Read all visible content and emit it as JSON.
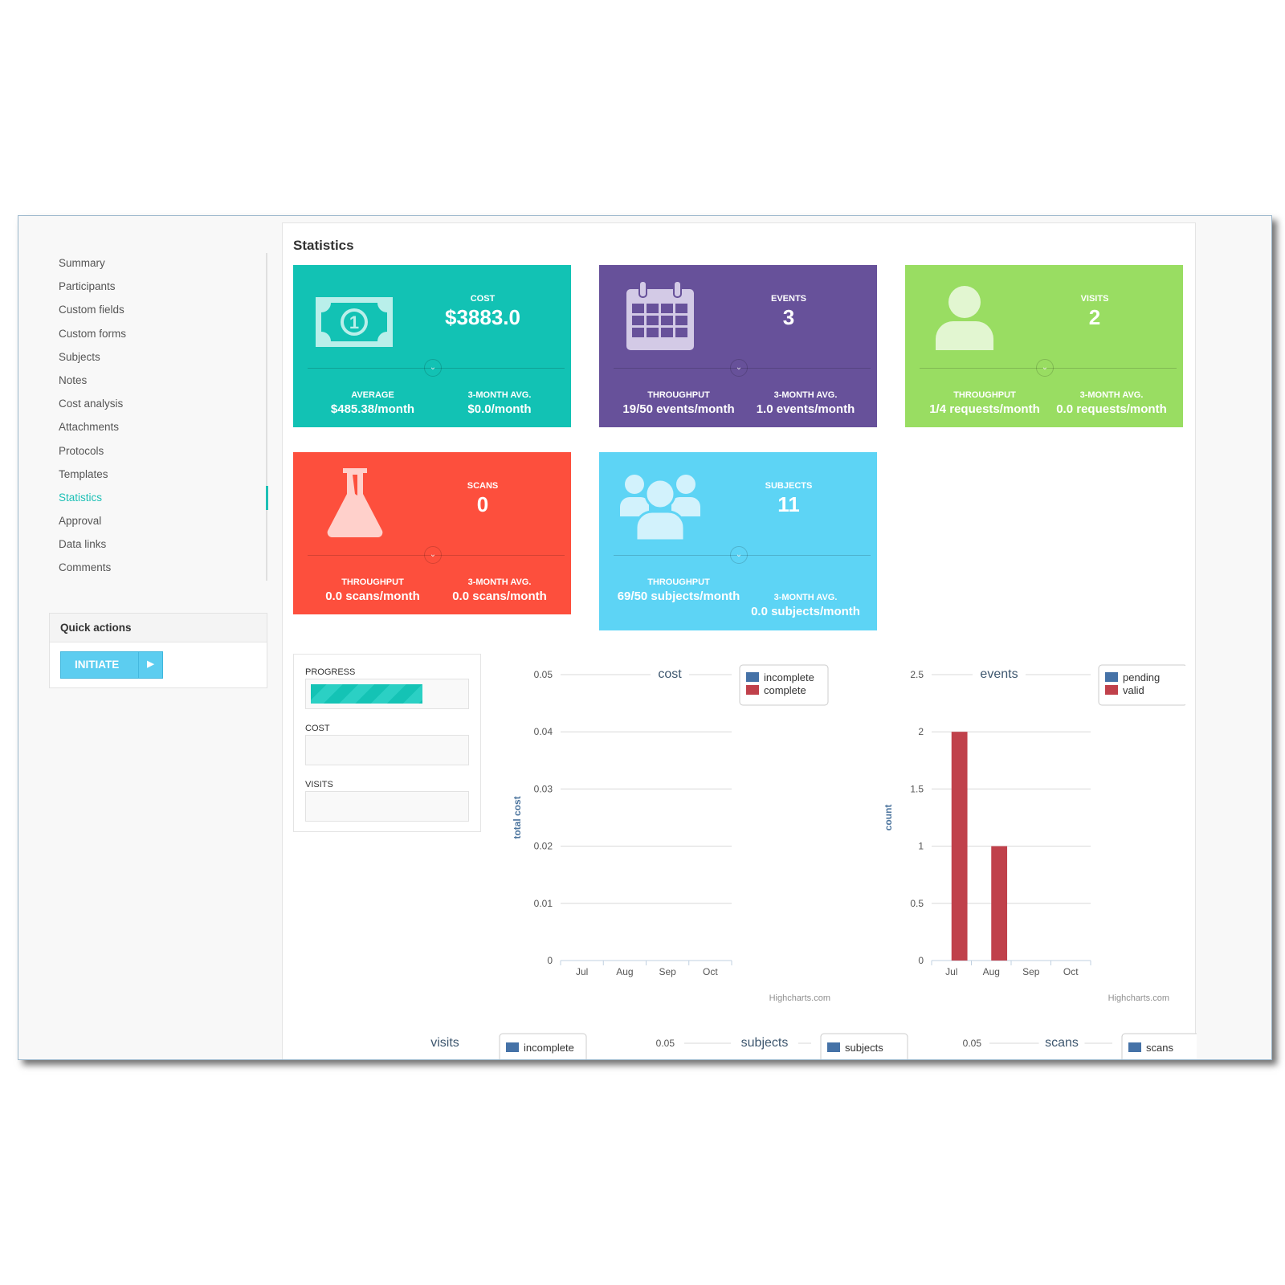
{
  "sidebar": {
    "items": [
      {
        "label": "Summary"
      },
      {
        "label": "Participants"
      },
      {
        "label": "Custom fields"
      },
      {
        "label": "Custom forms"
      },
      {
        "label": "Subjects"
      },
      {
        "label": "Notes"
      },
      {
        "label": "Cost analysis"
      },
      {
        "label": "Attachments"
      },
      {
        "label": "Protocols"
      },
      {
        "label": "Templates"
      },
      {
        "label": "Statistics",
        "active": true
      },
      {
        "label": "Approval"
      },
      {
        "label": "Data links"
      },
      {
        "label": "Comments"
      }
    ],
    "quick_actions": {
      "title": "Quick actions",
      "initiate_label": "INITIATE",
      "arrow_icon": "play-icon"
    }
  },
  "page": {
    "title": "Statistics"
  },
  "cards": [
    {
      "id": "cost",
      "icon": "banknote-icon",
      "label": "COST",
      "value": "$3883.0",
      "left_label": "AVERAGE",
      "left_value": "$485.38/month",
      "right_label": "3-MONTH AVG.",
      "right_value": "$0.0/month",
      "color": "#12c2b4"
    },
    {
      "id": "events",
      "icon": "calendar-icon",
      "label": "EVENTS",
      "value": "3",
      "left_label": "THROUGHPUT",
      "left_value": "19/50 events/month",
      "right_label": "3-MONTH AVG.",
      "right_value": "1.0 events/month",
      "color": "#67519a"
    },
    {
      "id": "visits",
      "icon": "user-icon",
      "label": "VISITS",
      "value": "2",
      "left_label": "THROUGHPUT",
      "left_value": "1/4 requests/month",
      "right_label": "3-MONTH AVG.",
      "right_value": "0.0 requests/month",
      "color": "#99dd62"
    },
    {
      "id": "scans",
      "icon": "flask-icon",
      "label": "SCANS",
      "value": "0",
      "left_label": "THROUGHPUT",
      "left_value": "0.0 scans/month",
      "right_label": "3-MONTH AVG.",
      "right_value": "0.0 scans/month",
      "color": "#fd4f3d"
    },
    {
      "id": "subjects",
      "icon": "group-icon",
      "label": "SUBJECTS",
      "value": "11",
      "left_label": "THROUGHPUT",
      "left_value": "69/50 subjects/month",
      "right_label": "3-MONTH AVG.",
      "right_value": "0.0 subjects/month",
      "color": "#5dd4f5"
    }
  ],
  "progress_panel": {
    "progress_label": "PROGRESS",
    "progress_fraction": 0.73,
    "cost_label": "COST",
    "visits_label": "VISITS"
  },
  "chart_data": [
    {
      "type": "bar",
      "title": "cost",
      "ylabel": "total cost",
      "xlabel": "",
      "categories": [
        "Jul",
        "Aug",
        "Sep",
        "Oct"
      ],
      "yticks": [
        "0",
        "0.01",
        "0.02",
        "0.03",
        "0.04",
        "0.05"
      ],
      "ylim": [
        0,
        0.05
      ],
      "series": [
        {
          "name": "incomplete",
          "color": "#4572a7",
          "values": [
            0,
            0,
            0,
            0
          ]
        },
        {
          "name": "complete",
          "color": "#c0414b",
          "values": [
            0,
            0,
            0,
            0
          ]
        }
      ],
      "legend": "top-right",
      "credit": "Highcharts.com"
    },
    {
      "type": "bar",
      "title": "events",
      "ylabel": "count",
      "xlabel": "",
      "categories": [
        "Jul",
        "Aug",
        "Sep",
        "Oct"
      ],
      "yticks": [
        "0",
        "0.5",
        "1",
        "1.5",
        "2",
        "2.5"
      ],
      "ylim": [
        0,
        2.5
      ],
      "series": [
        {
          "name": "pending",
          "color": "#4572a7",
          "values": [
            0,
            0,
            0,
            0
          ]
        },
        {
          "name": "valid",
          "color": "#c0414b",
          "values": [
            2,
            1,
            0,
            0
          ]
        }
      ],
      "legend": "top-right",
      "credit": "Highcharts.com"
    },
    {
      "type": "bar",
      "title": "visits",
      "series": [
        {
          "name": "incomplete",
          "color": "#4572a7",
          "values": []
        }
      ],
      "legend": "top-right"
    },
    {
      "type": "bar",
      "title": "subjects",
      "yticks": [
        "0.05"
      ],
      "series": [
        {
          "name": "subjects",
          "color": "#4572a7",
          "values": []
        }
      ],
      "legend": "top-right"
    },
    {
      "type": "bar",
      "title": "scans",
      "yticks": [
        "0.05"
      ],
      "series": [
        {
          "name": "scans",
          "color": "#4572a7",
          "values": []
        }
      ],
      "legend": "top-right"
    }
  ]
}
